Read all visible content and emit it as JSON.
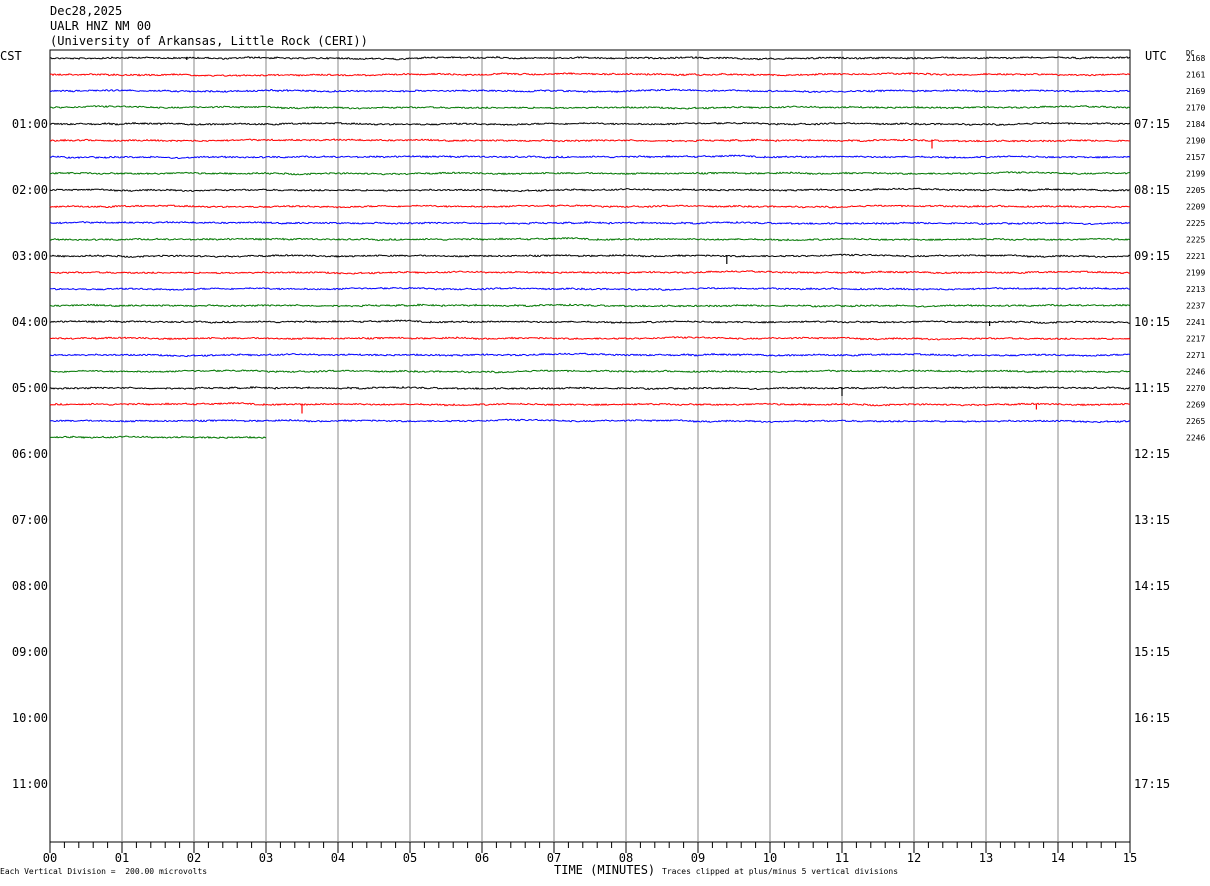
{
  "header": {
    "line1": "Dec28,2025",
    "line2": "UALR HNZ NM 00",
    "line3": "(University of Arkansas, Little Rock (CERI))"
  },
  "left_timezone": "CST",
  "right_timezone": "UTC",
  "dc_header": "DC",
  "footer": {
    "left_note": "Each Vertical Division =  200.00 microvolts",
    "x_title": "TIME (MINUTES)",
    "right_note": "Traces clipped at plus/minus 5 vertical divisions"
  },
  "chart_data": {
    "type": "line",
    "title": "UALR HNZ NM 00",
    "xlabel": "TIME (MINUTES)",
    "x_ticks": [
      "00",
      "01",
      "02",
      "03",
      "04",
      "05",
      "06",
      "07",
      "08",
      "09",
      "10",
      "11",
      "12",
      "13",
      "14",
      "15"
    ],
    "xlim": [
      0,
      15
    ],
    "trace_colors": [
      "#000000",
      "#ff0000",
      "#0000ff",
      "#007700"
    ],
    "hour_labels_cst": [
      "01:00",
      "02:00",
      "03:00",
      "04:00",
      "05:00",
      "06:00",
      "07:00",
      "08:00",
      "09:00",
      "10:00",
      "11:00"
    ],
    "hour_labels_utc": [
      "07:15",
      "08:15",
      "09:15",
      "10:15",
      "11:15",
      "12:15",
      "13:15",
      "14:15",
      "15:15",
      "16:15",
      "17:15"
    ],
    "dc_offsets": [
      "2168",
      "2161",
      "2169",
      "2170",
      "2184",
      "2190",
      "2157",
      "2199",
      "2205",
      "2209",
      "2225",
      "2225",
      "2221",
      "2199",
      "2213",
      "2237",
      "2241",
      "2217",
      "2271",
      "2246",
      "2270",
      "2269",
      "2265",
      "2246"
    ],
    "last_trace_end_minute": 3,
    "events": [
      {
        "trace": 0,
        "minute": 1.9,
        "amp": 2
      },
      {
        "trace": 5,
        "minute": 12.25,
        "amp": 8
      },
      {
        "trace": 12,
        "minute": 9.4,
        "amp": 8
      },
      {
        "trace": 16,
        "minute": 13.05,
        "amp": 4
      },
      {
        "trace": 20,
        "minute": 11.0,
        "amp": 8
      },
      {
        "trace": 21,
        "minute": 3.5,
        "amp": 9
      },
      {
        "trace": 21,
        "minute": 13.7,
        "amp": 5
      }
    ]
  }
}
